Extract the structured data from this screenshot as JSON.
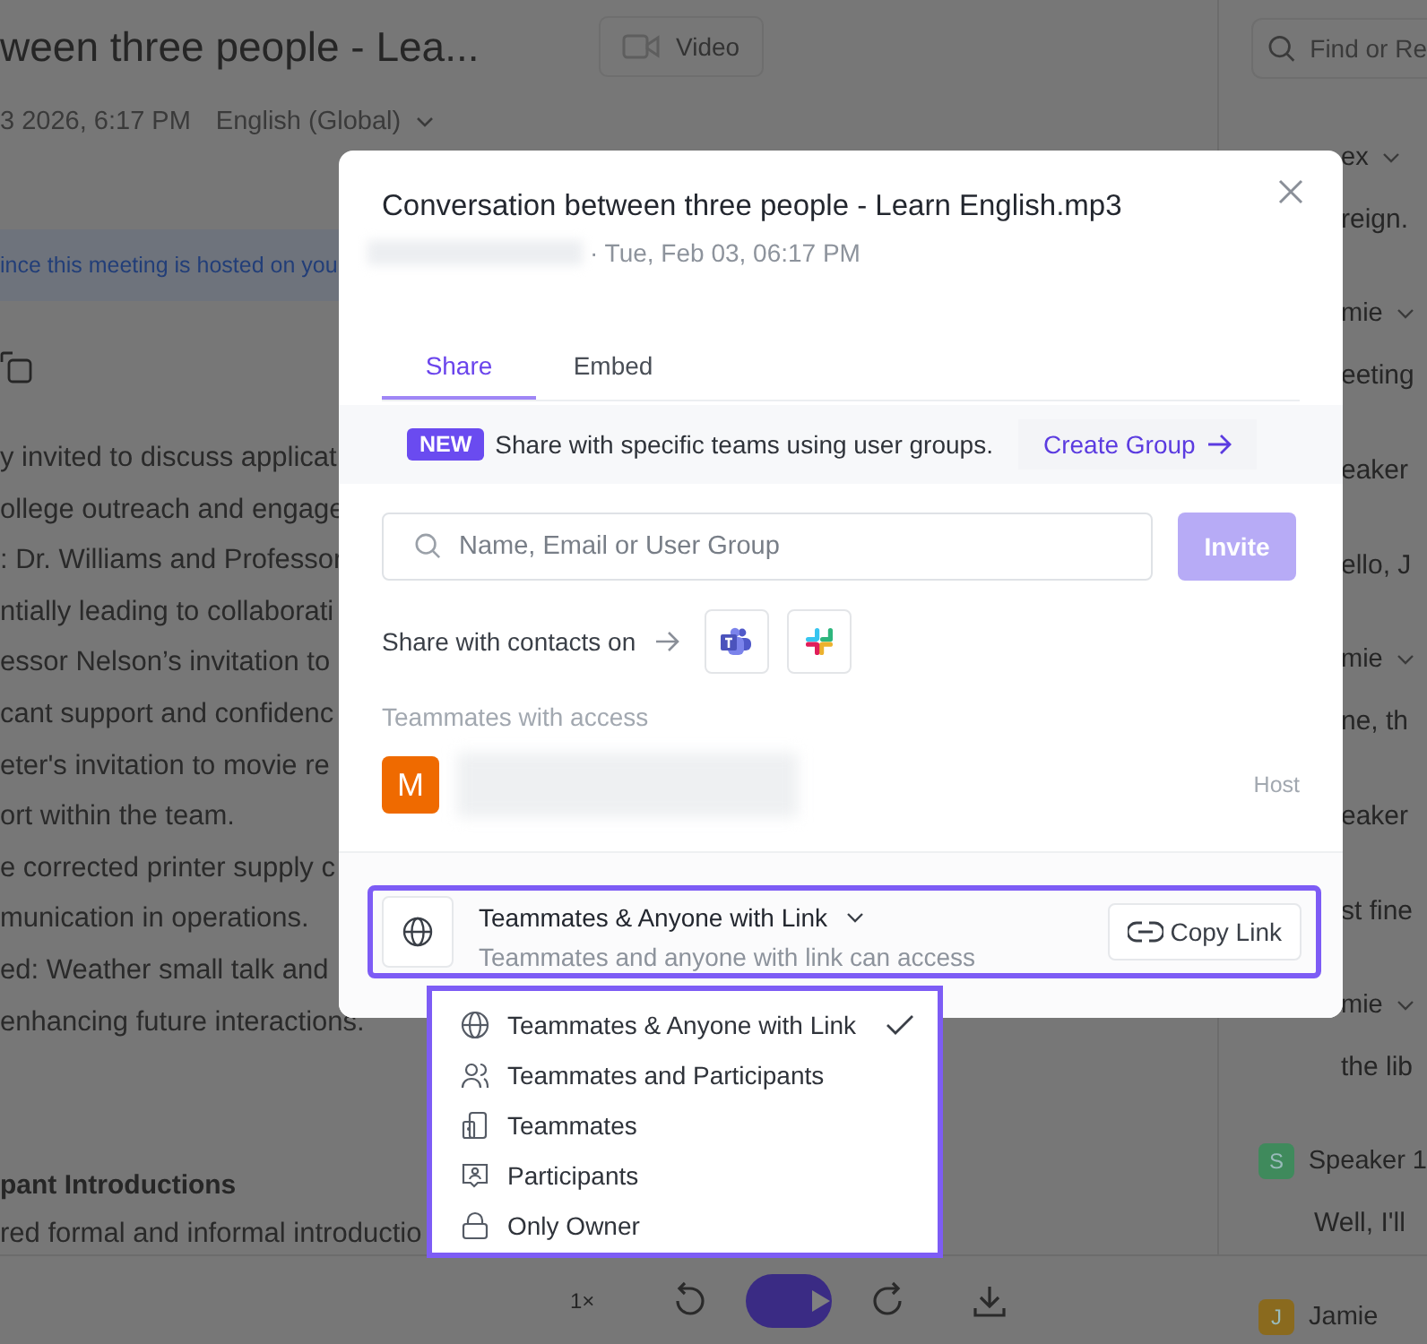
{
  "page": {
    "title": "ween three people - Lea...",
    "date": "3 2026, 6:17 PM",
    "language": "English (Global)",
    "video_button": "Video",
    "banner": "ince this meeting is hosted on you",
    "summary_lines": [
      "y invited to discuss applicat",
      "ollege outreach and engage",
      ": Dr. Williams and Professor",
      "ntially leading to collaborati",
      "essor Nelson’s invitation to",
      "cant support and confidenc",
      "eter's invitation to movie re",
      "ort within the team.",
      "e corrected printer supply c",
      "munication in operations.",
      "ed: Weather small talk and",
      "enhancing future interactions."
    ],
    "section_heading": "pant Introductions",
    "section_line": "red formal and informal introductio"
  },
  "sidebar": {
    "search": {
      "placeholder": "Find or Re"
    },
    "covered_fragments": [
      {
        "text": "ex",
        "chevron": true
      },
      {
        "text": "reign.",
        "chevron": false
      },
      {
        "text": "mie",
        "chevron": true
      },
      {
        "text": "eeting",
        "chevron": false
      },
      {
        "text": "eaker",
        "chevron": false
      },
      {
        "text": "ello, J",
        "chevron": false
      },
      {
        "text": "mie",
        "chevron": true
      },
      {
        "text": "ne, th",
        "chevron": false
      },
      {
        "text": "eaker",
        "chevron": false
      },
      {
        "text": "st fine",
        "chevron": false
      },
      {
        "text": "mie",
        "chevron": true
      },
      {
        "text": "the lib",
        "chevron": false
      }
    ],
    "entries": [
      {
        "kind": "speaker",
        "initial": "S",
        "name": "Speaker 1",
        "color": "#3f8a5c"
      },
      {
        "kind": "line",
        "text": "Well, I'll"
      },
      {
        "kind": "speaker",
        "initial": "J",
        "name": "Jamie",
        "color": "#8a6a1e"
      }
    ]
  },
  "player": {
    "speed": "1×"
  },
  "share_dialog": {
    "title": "Conversation between three people - Learn English.mp3",
    "subtitle": "· Tue, Feb 03, 06:17 PM",
    "tabs": [
      {
        "label": "Share",
        "selected": true
      },
      {
        "label": "Embed",
        "selected": false
      }
    ],
    "notice": {
      "badge": "NEW",
      "text": "Share with specific teams using user groups.",
      "link": "Create Group"
    },
    "search": {
      "placeholder": "Name, Email or User Group"
    },
    "invite": {
      "label": "Invite",
      "disabled": true
    },
    "contacts_label": "Share with contacts on",
    "access_heading": "Teammates with access",
    "members": [
      {
        "initial": "M",
        "role": "Host"
      }
    ],
    "access": {
      "label": "Teammates & Anyone with Link",
      "description": "Teammates and anyone with link can access",
      "copy": "Copy Link"
    }
  },
  "access_menu": {
    "options": [
      {
        "kind": "globe",
        "label": "Teammates & Anyone with Link",
        "selected": true
      },
      {
        "kind": "people",
        "label": "Teammates and Participants",
        "selected": false
      },
      {
        "kind": "teammates",
        "label": "Teammates",
        "selected": false
      },
      {
        "kind": "participants",
        "label": "Participants",
        "selected": false
      },
      {
        "kind": "lock",
        "label": "Only Owner",
        "selected": false
      }
    ]
  }
}
